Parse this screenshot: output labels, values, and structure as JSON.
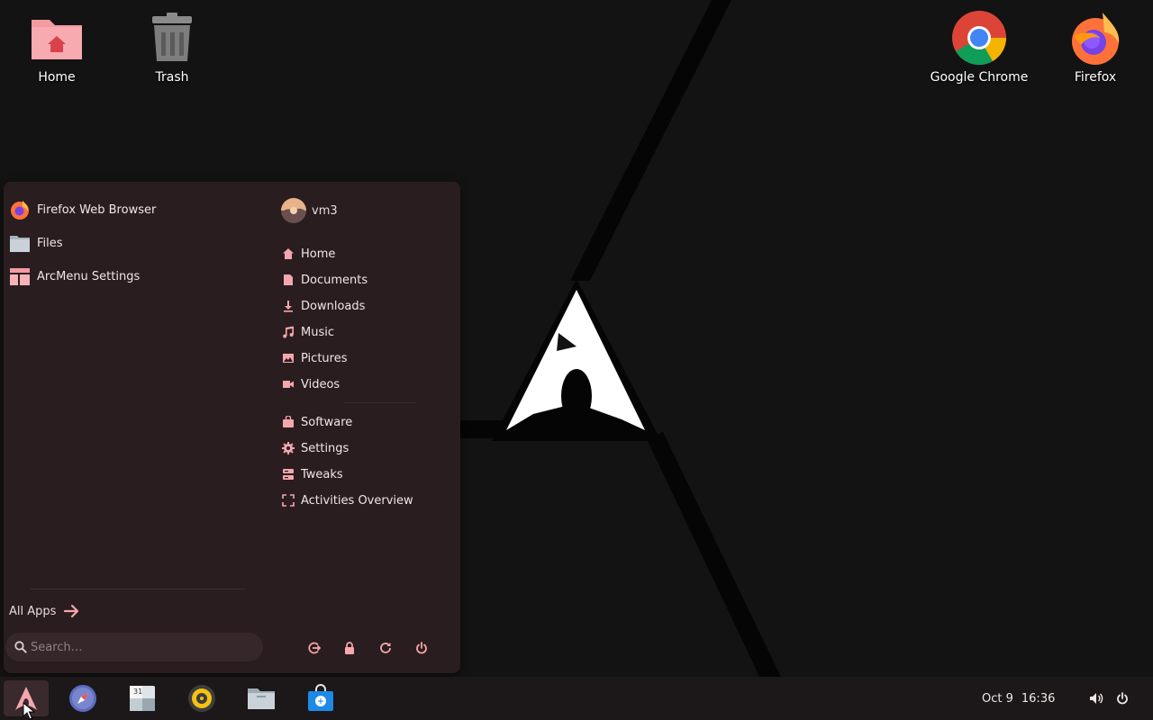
{
  "desktop": {
    "icons": [
      {
        "label": "Home",
        "icon": "home-folder-icon"
      },
      {
        "label": "Trash",
        "icon": "trash-icon"
      },
      {
        "label": "Google Chrome",
        "icon": "chrome-icon"
      },
      {
        "label": "Firefox",
        "icon": "firefox-icon"
      }
    ]
  },
  "menu": {
    "favorites": [
      {
        "label": "Firefox Web Browser",
        "icon": "firefox-icon"
      },
      {
        "label": "Files",
        "icon": "folder-icon"
      },
      {
        "label": "ArcMenu Settings",
        "icon": "arcmenu-settings-icon"
      }
    ],
    "user": {
      "name": "vm3",
      "icon": "avatar"
    },
    "places": [
      {
        "label": "Home",
        "icon": "home-icon"
      },
      {
        "label": "Documents",
        "icon": "document-icon"
      },
      {
        "label": "Downloads",
        "icon": "download-icon"
      },
      {
        "label": "Music",
        "icon": "music-icon"
      },
      {
        "label": "Pictures",
        "icon": "picture-icon"
      },
      {
        "label": "Videos",
        "icon": "video-icon"
      }
    ],
    "shortcuts": [
      {
        "label": "Software",
        "icon": "software-bag-icon"
      },
      {
        "label": "Settings",
        "icon": "gear-icon"
      },
      {
        "label": "Tweaks",
        "icon": "tweaks-icon"
      },
      {
        "label": "Activities Overview",
        "icon": "activities-icon"
      }
    ],
    "all_apps_label": "All Apps",
    "search_placeholder": "Search…",
    "power_buttons": [
      "logout-icon",
      "lock-icon",
      "restart-icon",
      "power-icon"
    ]
  },
  "taskbar": {
    "apps": [
      "arch-menu-icon",
      "web-browser-icon",
      "calendar-icon",
      "music-player-icon",
      "files-icon",
      "software-store-icon"
    ],
    "clock": {
      "date": "Oct 9",
      "time": "16:36"
    },
    "tray": [
      "volume-icon",
      "power-icon"
    ]
  },
  "colors": {
    "accent": "#f4a7ad",
    "menu_bg": "#2a1d1f",
    "desktop_bg": "#131313",
    "taskbar_bg": "#1c1718"
  }
}
